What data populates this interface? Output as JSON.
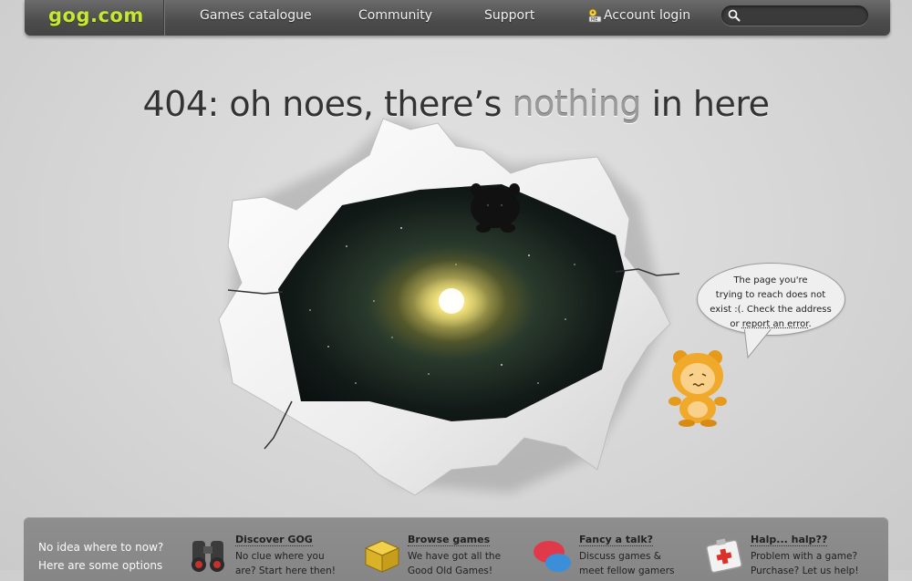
{
  "nav": {
    "logo": "gog.com",
    "links": [
      "Games catalogue",
      "Community",
      "Support"
    ],
    "account_login": "Account login",
    "search_placeholder": ""
  },
  "headline": {
    "part1": "404: oh noes, there’s ",
    "highlight": "nothing",
    "part2": " in here"
  },
  "bubble": {
    "line1": "The page you're",
    "line2": "trying to reach does not",
    "line3": "exist :(. Check the address",
    "line4_prefix": "or ",
    "link": "report an error",
    "line4_suffix": "."
  },
  "bottom": {
    "intro_line1": "No idea where to now?",
    "intro_line2": "Here are some options",
    "items": [
      {
        "title": "Discover GOG",
        "desc_line1": "No clue where you",
        "desc_line2": "are? Start here then!",
        "icon": "binoculars-icon"
      },
      {
        "title": "Browse games",
        "desc_line1": "We have got all the",
        "desc_line2": "Good Old Games!",
        "icon": "box-icon"
      },
      {
        "title": "Fancy a talk?",
        "desc_line1": "Discuss games &",
        "desc_line2": "meet fellow gamers",
        "icon": "chat-bubbles-icon"
      },
      {
        "title": "Halp... halp??",
        "desc_line1": "Problem with a game?",
        "desc_line2": "Purchase? Let us help!",
        "icon": "first-aid-icon"
      }
    ]
  },
  "colors": {
    "logo": "#c6e63a",
    "nav_bg": "#4c4c4c",
    "page_bg": "#d6d6d6",
    "bottom_panel": "#8a8a8a"
  }
}
